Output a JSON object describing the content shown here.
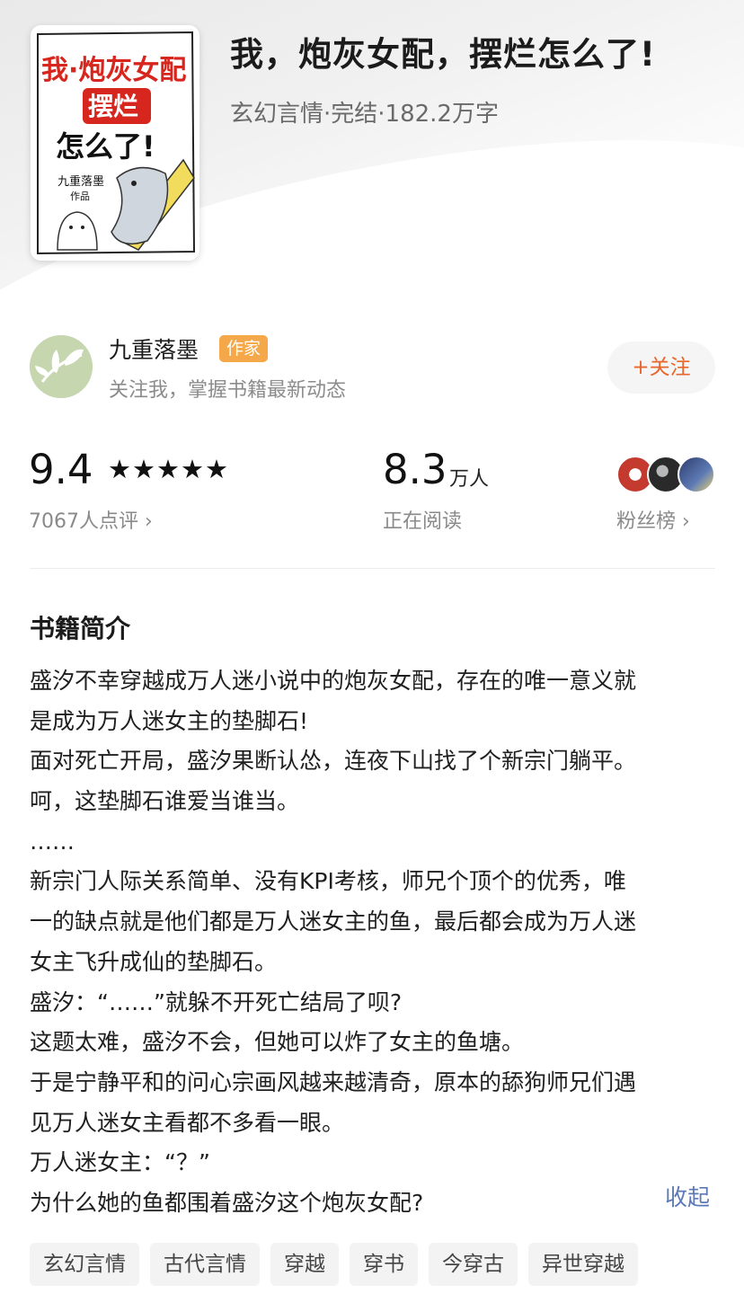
{
  "book": {
    "title": "我，炮灰女配，摆烂怎么了!",
    "meta": "玄幻言情·完结·182.2万字",
    "cover": {
      "title_line1": "我·炮灰女配",
      "title_line2": "摆烂",
      "title_line3": "怎么了!",
      "author_line1": "九重落墨",
      "author_line2": "作品"
    }
  },
  "author": {
    "name": "九重落墨",
    "badge": "作家",
    "description": "关注我，掌握书籍最新动态",
    "follow_label": "+关注"
  },
  "stats": {
    "rating": "9.4",
    "stars": "★★★★★",
    "star_count": 5,
    "review_count": "7067人点评 ›",
    "reading_number": "8.3",
    "reading_unit": "万人",
    "reading_label": "正在阅读",
    "fans_label": "粉丝榜 ›"
  },
  "synopsis": {
    "title": "书籍简介",
    "lines": [
      "盛汐不幸穿越成万人迷小说中的炮灰女配，存在的唯一意义就",
      "是成为万人迷女主的垫脚石!",
      "面对死亡开局，盛汐果断认怂，连夜下山找了个新宗门躺平。",
      "呵，这垫脚石谁爱当谁当。",
      "……",
      "新宗门人际关系简单、没有KPI考核，师兄个顶个的优秀，唯",
      "一的缺点就是他们都是万人迷女主的鱼，最后都会成为万人迷",
      "女主飞升成仙的垫脚石。",
      "盛汐：“……”就躲不开死亡结局了呗?",
      "这题太难，盛汐不会，但她可以炸了女主的鱼塘。",
      "于是宁静平和的问心宗画风越来越清奇，原本的舔狗师兄们遇",
      "见万人迷女主看都不多看一眼。",
      "万人迷女主：“？”",
      "为什么她的鱼都围着盛汐这个炮灰女配?"
    ],
    "collapse_label": "收起"
  },
  "tags": [
    "玄幻言情",
    "古代言情",
    "穿越",
    "穿书",
    "今穿古",
    "异世穿越"
  ],
  "colors": {
    "accent": "#e8662b",
    "badge": "#f5a849",
    "link": "#5b79b6",
    "cover_title_red": "#d7261e"
  }
}
